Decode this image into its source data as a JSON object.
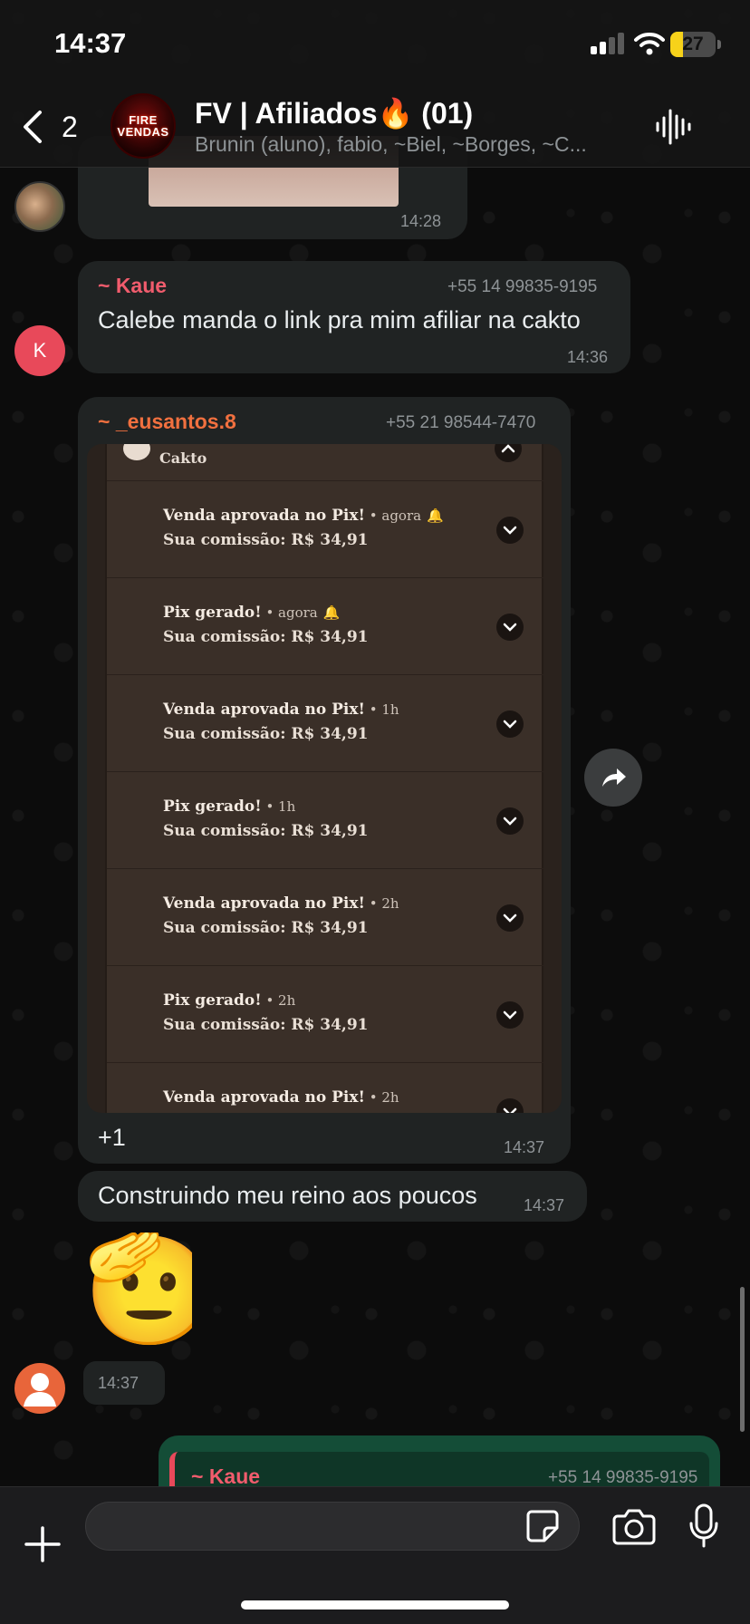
{
  "status_bar": {
    "time": "14:37",
    "battery": "27",
    "battery_level_percent": 27
  },
  "header": {
    "back_count": "2",
    "avatar_text_1": "FIRE",
    "avatar_text_2": "VENDAS",
    "title": "FV | Afiliados🔥 (01)",
    "members": "Brunin (aluno), fabio, ~Biel, ~Borges, ~C..."
  },
  "messages": {
    "image_msg": {
      "time": "14:28"
    },
    "kaue_msg": {
      "sender": "~ Kaue",
      "phone": "+55 14 99835-9195",
      "avatar_letter": "K",
      "text": "Calebe manda o link pra mim afiliar na cakto",
      "time": "14:36"
    },
    "eusantos_msg": {
      "sender": "~ _eusantos.8",
      "phone": "+55 21 98544-7470",
      "extra": "+1",
      "time": "14:37"
    },
    "reino_msg": {
      "text": "Construindo meu reino aos poucos",
      "time": "14:37"
    },
    "emoji_msg": {
      "emoji": "🫡",
      "time": "14:37"
    },
    "reply_msg": {
      "sender": "~ Kaue",
      "phone": "+55 14 99835-9195"
    }
  },
  "screenshot": {
    "app_name": "Cakto",
    "notifications": [
      {
        "title": "Venda aprovada no Pix!",
        "time": " • agora",
        "body": "Sua comissão: R$ 34,91"
      },
      {
        "title": "Pix gerado!",
        "time": " • agora",
        "body": "Sua comissão: R$ 34,91"
      },
      {
        "title": "Venda aprovada no Pix!",
        "time": " • 1h",
        "body": "Sua comissão: R$ 34,91"
      },
      {
        "title": "Pix gerado!",
        "time": " • 1h",
        "body": "Sua comissão: R$ 34,91"
      },
      {
        "title": "Venda aprovada no Pix!",
        "time": " • 2h",
        "body": "Sua comissão: R$ 34,91"
      },
      {
        "title": "Pix gerado!",
        "time": " • 2h",
        "body": "Sua comissão: R$ 34,91"
      },
      {
        "title": "Venda aprovada no Pix!",
        "time": " • 2h",
        "body": ""
      }
    ]
  },
  "input": {
    "placeholder": ""
  },
  "colors": {
    "kaue_name": "#f15c6d",
    "eusantos_name": "#f1703f",
    "bubble_in": "#202323",
    "bubble_out": "#144d37",
    "battery": "#f7d21a"
  }
}
